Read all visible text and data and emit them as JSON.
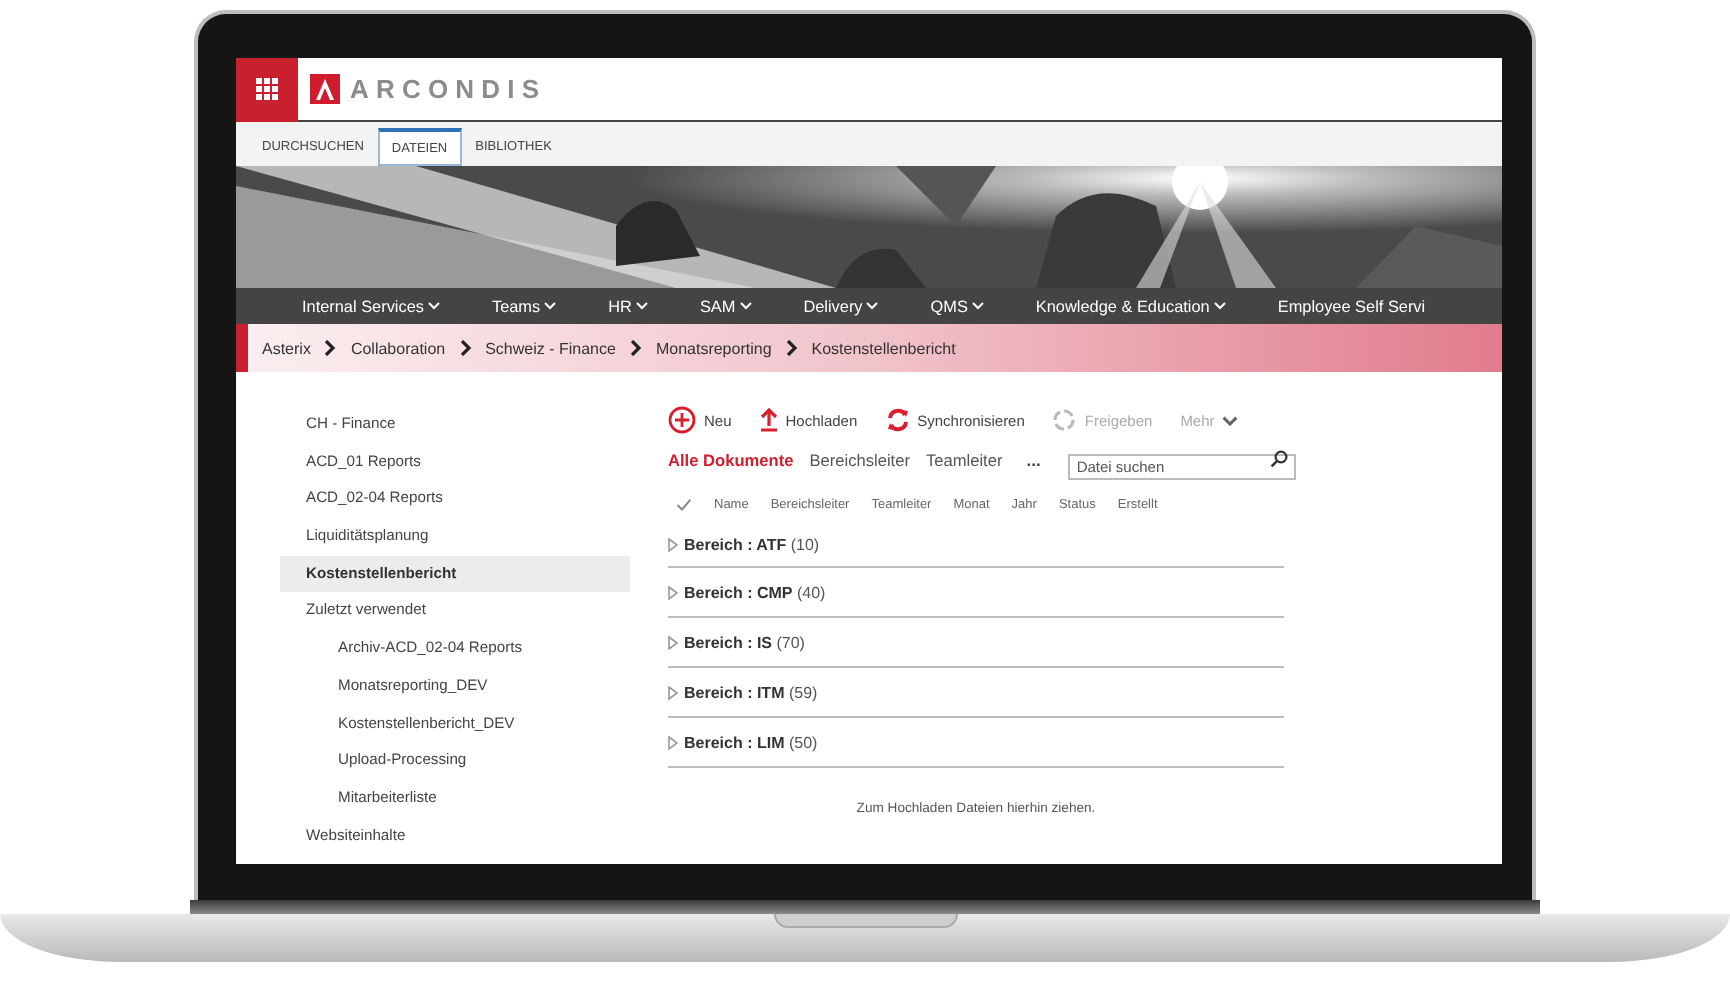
{
  "header": {
    "brand": "ARCONDIS"
  },
  "ribbon_tabs": [
    {
      "label": "DURCHSUCHEN",
      "selected": false
    },
    {
      "label": "DATEIEN",
      "selected": true
    },
    {
      "label": "BIBLIOTHEK",
      "selected": false
    }
  ],
  "banner": {
    "kind": "picture"
  },
  "nav": [
    {
      "label": "Internal Services"
    },
    {
      "label": "Teams"
    },
    {
      "label": "HR"
    },
    {
      "label": "SAM"
    },
    {
      "label": "Delivery"
    },
    {
      "label": "QMS"
    },
    {
      "label": "Knowledge & Education"
    },
    {
      "label": "Employee Self Servi"
    }
  ],
  "breadcrumb": [
    "Asterix",
    "Collaboration",
    "Schweiz - Finance",
    "Monatsreporting",
    "Kostenstellenbericht"
  ],
  "sidebar": {
    "items": [
      {
        "label": "CH - Finance",
        "selected": false
      },
      {
        "label": "ACD_01 Reports",
        "selected": false
      },
      {
        "label": "ACD_02-04 Reports",
        "selected": false
      },
      {
        "label": "Liquiditätsplanung",
        "selected": false
      },
      {
        "label": "Kostenstellenbericht",
        "selected": true
      },
      {
        "label": "Zuletzt verwendet",
        "selected": false,
        "children": [
          {
            "label": "Archiv-ACD_02-04 Reports",
            "selected": false
          },
          {
            "label": "Monatsreporting_DEV",
            "selected": false
          },
          {
            "label": "Kostenstellenbericht_DEV",
            "selected": false
          },
          {
            "label": "Upload-Processing",
            "selected": false
          },
          {
            "label": "Mitarbeiterliste",
            "selected": false
          }
        ]
      },
      {
        "label": "Websiteinhalte",
        "selected": false
      }
    ]
  },
  "toolbar": [
    {
      "kind": "new",
      "label": "Neu",
      "disabled": false
    },
    {
      "kind": "upload",
      "label": "Hochladen",
      "disabled": false
    },
    {
      "kind": "sync",
      "label": "Synchronisieren",
      "disabled": false
    },
    {
      "kind": "share",
      "label": "Freigeben",
      "disabled": true
    },
    {
      "kind": "more",
      "label": "Mehr",
      "disabled": true
    }
  ],
  "views": [
    {
      "label": "Alle Dokumente",
      "selected": true
    },
    {
      "label": "Bereichsleiter",
      "selected": false
    },
    {
      "label": "Teamleiter",
      "selected": false
    }
  ],
  "views_more": "...",
  "search": {
    "placeholder": "Datei suchen"
  },
  "columns": [
    "Name",
    "Bereichsleiter",
    "Teamleiter",
    "Monat",
    "Jahr",
    "Status",
    "Erstellt"
  ],
  "groups": [
    {
      "label": "**Bereich : ATF** (10)",
      "expanded": false
    },
    {
      "label": "**Bereich : CMP** (40)",
      "expanded": false
    },
    {
      "label": "**Bereich : IS** (70)",
      "expanded": false
    },
    {
      "label": "**Bereich : ITM** (59)",
      "expanded": false
    },
    {
      "label": "**Bereich : LIM** (50)",
      "expanded": false
    }
  ],
  "drop_hint": "Zum Hochladen Dateien hierhin ziehen."
}
